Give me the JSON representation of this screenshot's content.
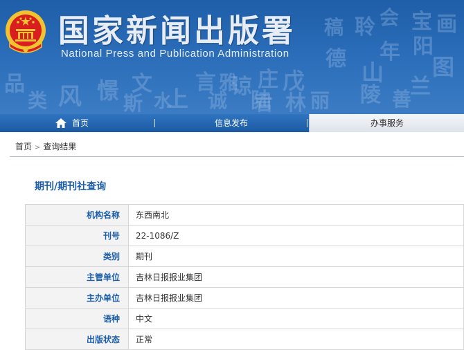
{
  "header": {
    "title": "国家新闻出版署",
    "subtitle": "National Press and Publication Administration",
    "background_calligraphy": [
      "品",
      "风",
      "类",
      "憬",
      "文",
      "上",
      "斯",
      "水",
      "言",
      "诚",
      "谅",
      "陆",
      "雅",
      "庄",
      "君",
      "戊",
      "林",
      "丽",
      "年",
      "山",
      "德",
      "聆",
      "稿",
      "会",
      "陵",
      "宝",
      "阳",
      "图",
      "画",
      "兰",
      "善"
    ]
  },
  "nav": {
    "home_label": "首页",
    "news_label": "信息发布",
    "service_label": "办事服务"
  },
  "breadcrumb": {
    "home": "首页",
    "separator": ">",
    "current": "查询结果"
  },
  "section": {
    "title": "期刊/期刊社查询"
  },
  "record": {
    "fields": [
      {
        "label": "机构名称",
        "value": "东西南北"
      },
      {
        "label": "刊号",
        "value": "22-1086/Z"
      },
      {
        "label": "类别",
        "value": "期刊"
      },
      {
        "label": "主管单位",
        "value": "吉林日报报业集团"
      },
      {
        "label": "主办单位",
        "value": "吉林日报报业集团"
      },
      {
        "label": "语种",
        "value": "中文"
      },
      {
        "label": "出版状态",
        "value": "正常"
      }
    ]
  },
  "colors": {
    "banner_blue": "#2a6cb8",
    "nav_blue": "#1c5aa3",
    "label_blue": "#1c5ea8",
    "emblem_red": "#d81e1e",
    "emblem_gold": "#f2c230"
  }
}
